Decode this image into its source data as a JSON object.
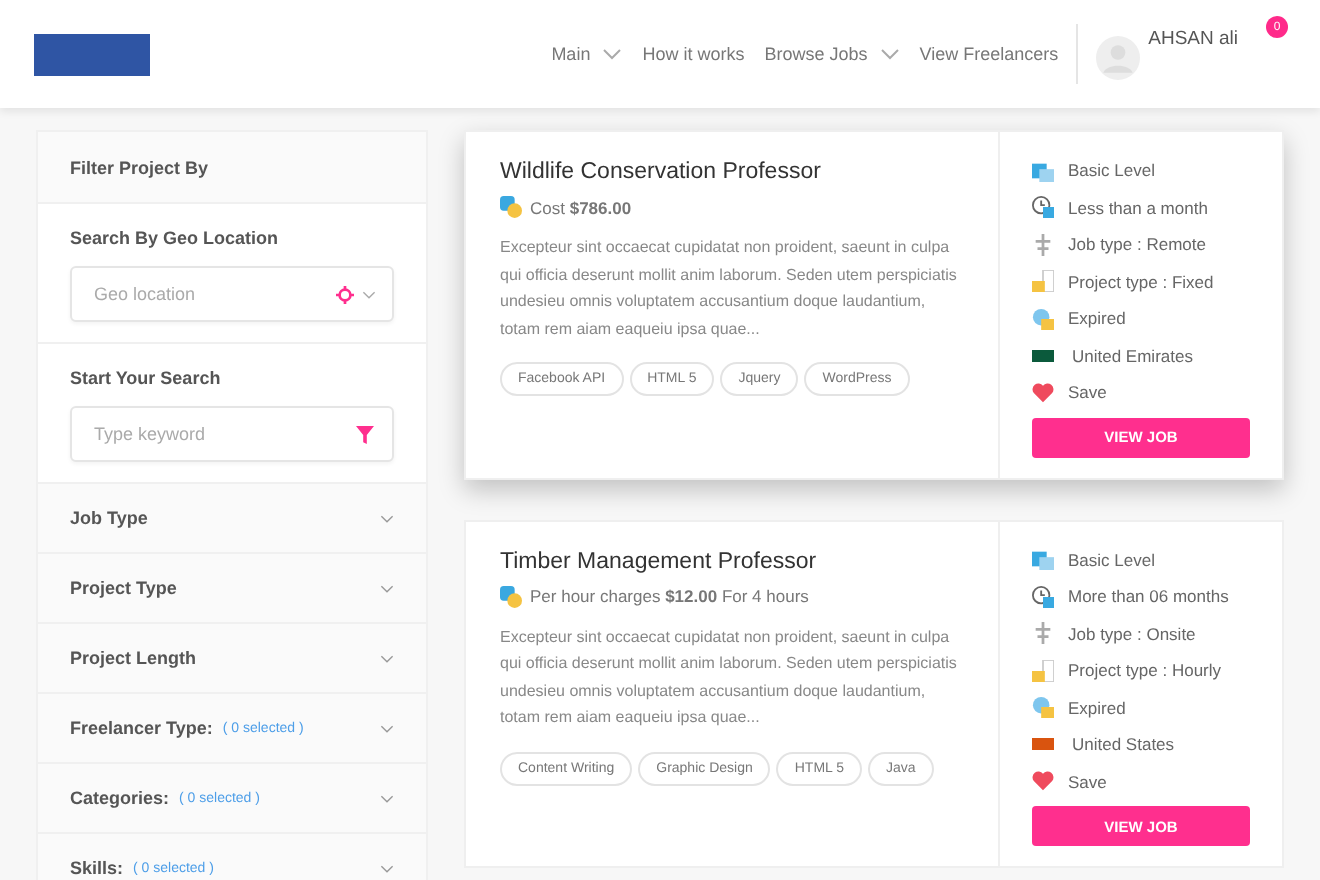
{
  "header": {
    "nav": [
      {
        "label": "Main",
        "dropdown": true
      },
      {
        "label": "How it works",
        "dropdown": false
      },
      {
        "label": "Browse Jobs",
        "dropdown": true
      },
      {
        "label": "View Freelancers",
        "dropdown": false
      }
    ],
    "user": {
      "name": "AHSAN ali",
      "notifications": "0"
    }
  },
  "sidebar": {
    "title": "Filter Project By",
    "geo": {
      "label": "Search By Geo Location",
      "placeholder": "Geo location"
    },
    "search": {
      "label": "Start Your Search",
      "placeholder": "Type keyword"
    },
    "filters": [
      {
        "label": "Job Type"
      },
      {
        "label": "Project Type"
      },
      {
        "label": "Project Length"
      },
      {
        "label": "Freelancer Type:",
        "count": "( 0 selected )"
      },
      {
        "label": "Categories:",
        "count": "( 0 selected )"
      },
      {
        "label": "Skills:",
        "count": "( 0 selected )"
      }
    ]
  },
  "jobs": [
    {
      "title": "Wildlife Conservation Professor",
      "elevated": true,
      "price": "Cost **$786.00**",
      "description": "Excepteur sint occaecat cupidatat non proident, saeunt in culpa qui officia deserunt mollit anim laborum. Seden utem perspiciatis undesieu omnis voluptatem accusantium doque laudantium, totam rem aiam eaqueiu ipsa quae...",
      "tags": [
        "Facebook API",
        "HTML 5",
        "Jquery",
        "WordPress"
      ],
      "details": [
        {
          "kind": "level",
          "text": "Basic Level"
        },
        {
          "kind": "duration",
          "text": "Less than a month"
        },
        {
          "kind": "job_type",
          "text": "Job type : Remote"
        },
        {
          "kind": "project_type",
          "text": "Project type : Fixed"
        },
        {
          "kind": "status",
          "text": "Expired"
        },
        {
          "kind": "country",
          "text": "United Emirates",
          "color": "#0b5a3c"
        },
        {
          "kind": "save",
          "text": "Save"
        }
      ],
      "button": "VIEW JOB"
    },
    {
      "title": "Timber Management Professor",
      "elevated": false,
      "price": "Per hour charges **$12.00** For 4 hours",
      "description": "Excepteur sint occaecat cupidatat non proident, saeunt in culpa qui officia deserunt mollit anim laborum. Seden utem perspiciatis undesieu omnis voluptatem accusantium doque laudantium, totam rem aiam eaqueiu ipsa quae...",
      "tags": [
        "Content Writing",
        "Graphic Design",
        "HTML 5",
        "Java"
      ],
      "details": [
        {
          "kind": "level",
          "text": "Basic Level"
        },
        {
          "kind": "duration",
          "text": "More than 06 months"
        },
        {
          "kind": "job_type",
          "text": "Job type : Onsite"
        },
        {
          "kind": "project_type",
          "text": "Project type : Hourly"
        },
        {
          "kind": "status",
          "text": "Expired"
        },
        {
          "kind": "country",
          "text": "United States",
          "color": "#d9540f"
        },
        {
          "kind": "save",
          "text": "Save"
        }
      ],
      "button": "VIEW JOB"
    }
  ]
}
